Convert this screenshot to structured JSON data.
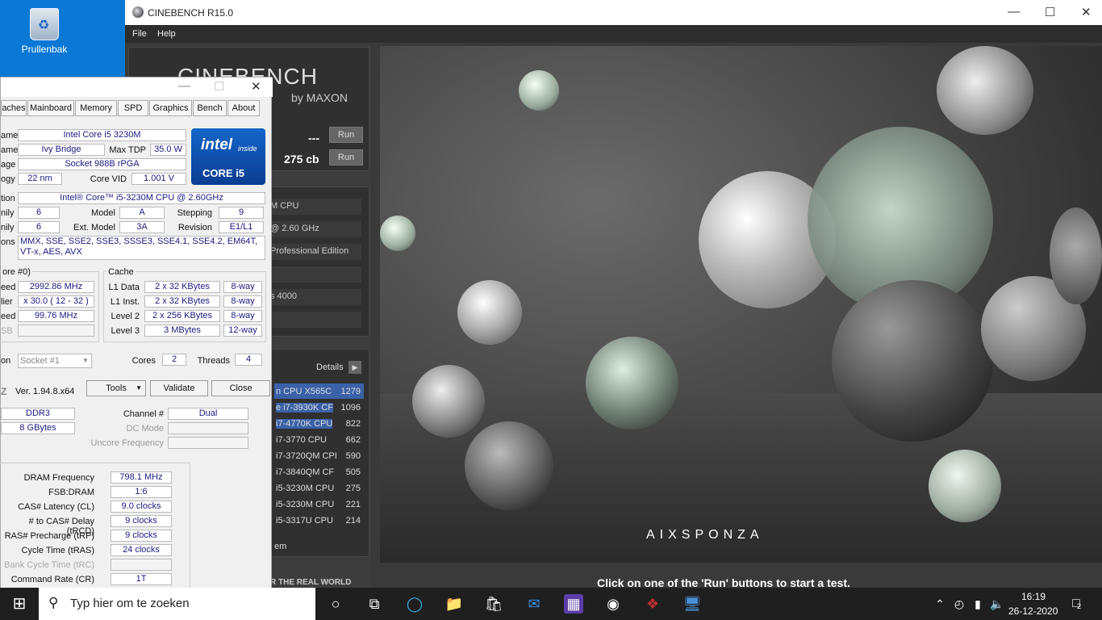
{
  "desktop": {
    "recycle_label": "Prullenbak"
  },
  "cinebench": {
    "title": "CINEBENCH R15.0",
    "menu": [
      "File",
      "Help"
    ],
    "logo": "CINEBENCH R15",
    "logo_sub": "by MAXON",
    "opengl_value": "---",
    "cpu_value": "275 cb",
    "run_label": "Run",
    "info": [
      "M CPU",
      "@ 2.60 GHz",
      "Professional Edition",
      "",
      "s 4000",
      ""
    ],
    "details_label": "Details",
    "ranking": [
      {
        "name": "n CPU X565C",
        "score": "1279"
      },
      {
        "name": "e i7-3930K CF",
        "score": "1096"
      },
      {
        "name": "i7-4770K CPU",
        "score": "822"
      },
      {
        "name": "i7-3770 CPU",
        "score": "662"
      },
      {
        "name": "i7-3720QM CPI",
        "score": "590"
      },
      {
        "name": "i7-3840QM CF",
        "score": "505"
      },
      {
        "name": "i5-3230M CPU",
        "score": "275"
      },
      {
        "name": "i5-3230M CPU",
        "score": "221"
      },
      {
        "name": "i5-3317U CPU",
        "score": "214"
      }
    ],
    "footer_item": "em",
    "tagline": "R THE REAL WORLD",
    "status": "Click on one of the 'Run' buttons to start a test.",
    "scene_brand": "AIXSPONZA",
    "colors": {
      "highlight": "#3b62a8",
      "panel": "#303030"
    }
  },
  "cpuz": {
    "tabs": [
      "aches",
      "Mainboard",
      "Memory",
      "SPD",
      "Graphics",
      "Bench",
      "About"
    ],
    "labels": {
      "name": "ame",
      "codename": "ame",
      "package": "age",
      "technology": "ogy",
      "spec": "tion",
      "family": "nily",
      "extfamily": "nily",
      "instr": "ons",
      "maxtdp": "Max TDP",
      "corevid": "Core VID",
      "model": "Model",
      "extmodel": "Ext. Model",
      "stepping": "Stepping",
      "revision": "Revision"
    },
    "values": {
      "name": "Intel Core i5 3230M",
      "codename": "Ivy Bridge",
      "maxtdp": "35.0 W",
      "package": "Socket 988B rPGA",
      "technology": "22 nm",
      "corevid": "1.001 V",
      "spec": "Intel® Core™ i5-3230M CPU @ 2.60GHz",
      "family": "6",
      "model": "A",
      "stepping": "9",
      "extfamily": "6",
      "extmodel": "3A",
      "revision": "E1/L1",
      "instructions": "MMX, SSE, SSE2, SSE3, SSSE3, SSE4.1, SSE4.2, EM64T, VT-x, AES, AVX"
    },
    "intel_badge": {
      "brand": "intel",
      "inside": "inside",
      "core": "CORE i5"
    },
    "clocks": {
      "group": "ore #0)",
      "l_speed": "eed",
      "speed": "2992.86 MHz",
      "l_mult": "lier",
      "mult": "x 30.0 ( 12 - 32 )",
      "l_bus": "eed",
      "bus": "99.76 MHz",
      "l_fsb": "SB"
    },
    "cache": {
      "group": "Cache",
      "rows": [
        {
          "label": "L1 Data",
          "size": "2 x 32 KBytes",
          "way": "8-way"
        },
        {
          "label": "L1 Inst.",
          "size": "2 x 32 KBytes",
          "way": "8-way"
        },
        {
          "label": "Level 2",
          "size": "2 x 256 KBytes",
          "way": "8-way"
        },
        {
          "label": "Level 3",
          "size": "3 MBytes",
          "way": "12-way"
        }
      ]
    },
    "selection_label": "on",
    "socket": "Socket #1",
    "cores_label": "Cores",
    "cores": "2",
    "threads_label": "Threads",
    "threads": "4",
    "version": "Ver. 1.94.8.x64",
    "tools": "Tools",
    "validate": "Validate",
    "close": "Close",
    "memory": {
      "type": "DDR3",
      "size": "8 GBytes",
      "channel_label": "Channel #",
      "channel": "Dual",
      "dc_label": "DC Mode",
      "uncore_label": "Uncore Frequency"
    },
    "timings": [
      {
        "label": "DRAM Frequency",
        "value": "798.1 MHz"
      },
      {
        "label": "FSB:DRAM",
        "value": "1:6"
      },
      {
        "label": "CAS# Latency (CL)",
        "value": "9.0 clocks"
      },
      {
        "label": "# to CAS# Delay (tRCD)",
        "value": "9 clocks"
      },
      {
        "label": "RAS# Precharge (tRP)",
        "value": "9 clocks"
      },
      {
        "label": "Cycle Time (tRAS)",
        "value": "24 clocks"
      },
      {
        "label": "Bank Cycle Time (tRC)",
        "value": ""
      },
      {
        "label": "Command Rate (CR)",
        "value": "1T"
      }
    ]
  },
  "taskbar": {
    "search_placeholder": "Typ hier om te zoeken",
    "time": "16:19",
    "date": "26-12-2020",
    "notifications": "2"
  }
}
